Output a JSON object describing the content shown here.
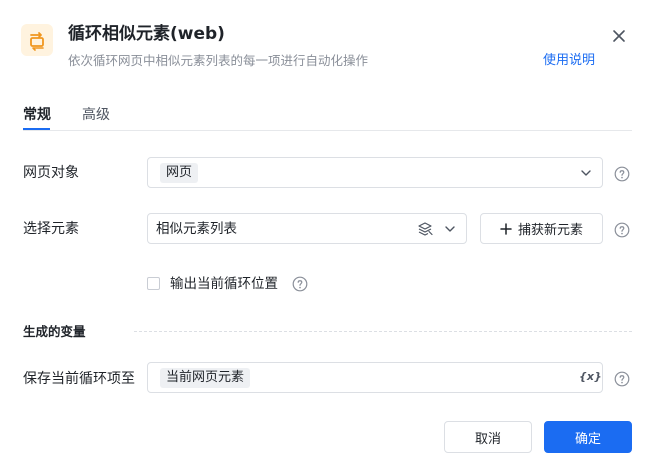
{
  "header": {
    "title": "循环相似元素(web)",
    "subtitle": "依次循环网页中相似元素列表的每一项进行自动化操作",
    "help_link": "使用说明",
    "app_icon": "loop-icon",
    "close_icon": "close-icon"
  },
  "tabs": [
    {
      "label": "常规",
      "active": true
    },
    {
      "label": "高级",
      "active": false
    }
  ],
  "form": {
    "web_object": {
      "label": "网页对象",
      "value": "网页"
    },
    "select_element": {
      "label": "选择元素",
      "value": "相似元素列表",
      "capture_button": "捕获新元素"
    },
    "output_position": {
      "label": "输出当前循环位置",
      "checked": false
    },
    "section_title": "生成的变量",
    "save_current": {
      "label": "保存当前循环项至",
      "value": "当前网页元素",
      "var_icon": "{x}"
    }
  },
  "footer": {
    "cancel_label": "取消",
    "ok_label": "确定"
  },
  "colors": {
    "accent": "#1b6cf2",
    "icon_orange": "#f0961e",
    "text_primary": "#1f2329",
    "text_secondary": "#8a8f99"
  }
}
